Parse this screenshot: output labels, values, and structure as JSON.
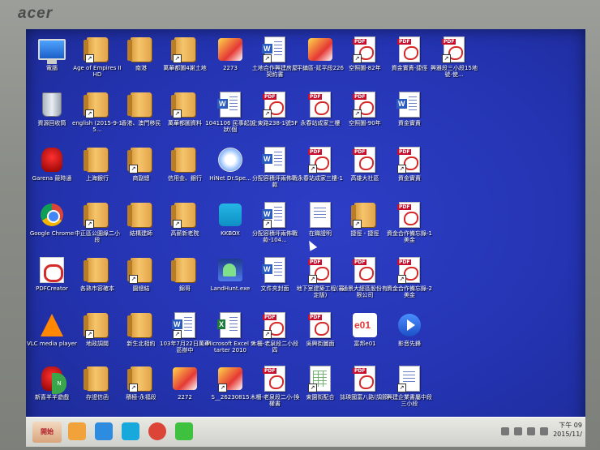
{
  "monitor": {
    "brand": "acer"
  },
  "desktop": {
    "icons": [
      {
        "name": "this-pc",
        "label": "電腦",
        "kind": "pc",
        "icon": "computer-icon"
      },
      {
        "name": "age-of-empires",
        "label": "Age of Empires II HD",
        "kind": "folder",
        "icon": "folder-icon"
      },
      {
        "name": "folder-nangang",
        "label": "南港",
        "kind": "folder",
        "icon": "folder-icon"
      },
      {
        "name": "folder-wanhua-map",
        "label": "萬華都圖4謝土地",
        "kind": "folder",
        "icon": "folder-icon"
      },
      {
        "name": "app-2273",
        "label": "2273",
        "kind": "wave",
        "icon": "image-icon"
      },
      {
        "name": "doc-land-cooperation",
        "label": "土地合作興建房屋契約書",
        "kind": "word",
        "icon": "word-doc-icon"
      },
      {
        "name": "doc-pingzhen",
        "label": "平鎮區-延平段226",
        "kind": "wave",
        "icon": "image-icon"
      },
      {
        "name": "pdf-aerial-82",
        "label": "空照圖-82年",
        "kind": "pdf",
        "icon": "pdf-icon"
      },
      {
        "name": "pdf-capital",
        "label": "資金實責-捷徑",
        "kind": "pdf",
        "icon": "pdf-icon"
      },
      {
        "name": "pdf-xingmei",
        "label": "興雅段三小段15地號-使...",
        "kind": "pdf",
        "icon": "pdf-icon"
      },
      {
        "name": "recycle-bin",
        "label": "資源回收筒",
        "kind": "bin",
        "icon": "recycle-bin-icon"
      },
      {
        "name": "folder-english",
        "label": "english (2015-9-15...",
        "kind": "folder",
        "icon": "folder-icon"
      },
      {
        "name": "folder-hk-macau",
        "label": "香港、澳門移民",
        "kind": "folder",
        "icon": "folder-icon"
      },
      {
        "name": "folder-wanhua-data",
        "label": "萬華都圖資料",
        "kind": "folder",
        "icon": "folder-icon"
      },
      {
        "name": "doc-1041106",
        "label": "1041106 民事起訴狀(個",
        "kind": "word",
        "icon": "word-doc-icon"
      },
      {
        "name": "pdf-shidong",
        "label": "士東路238-1號5F",
        "kind": "pdf",
        "icon": "pdf-icon"
      },
      {
        "name": "pdf-yongchun-1",
        "label": "永春站成家三樓",
        "kind": "pdf",
        "icon": "pdf-icon"
      },
      {
        "name": "pdf-aerial-90",
        "label": "空照圖-90年",
        "kind": "pdf",
        "icon": "pdf-icon"
      },
      {
        "name": "doc-capital",
        "label": "資金實責",
        "kind": "word",
        "icon": "word-doc-icon"
      },
      {
        "name": "garena",
        "label": "Garena 競時通",
        "kind": "garena",
        "icon": "garena-icon"
      },
      {
        "name": "folder-shanghai-bank",
        "label": "上海銀行",
        "kind": "folder",
        "icon": "folder-icon"
      },
      {
        "name": "folder-shangban",
        "label": "商副總",
        "kind": "folder",
        "icon": "folder-icon"
      },
      {
        "name": "folder-credit",
        "label": "信用金、銀行",
        "kind": "folder",
        "icon": "folder-icon"
      },
      {
        "name": "hinet",
        "label": "HiNet Dr.Spe...",
        "kind": "hinet",
        "icon": "hinet-icon"
      },
      {
        "name": "doc-allocation",
        "label": "分配容積坪兩佈戰款",
        "kind": "word",
        "icon": "word-doc-icon"
      },
      {
        "name": "pdf-yongchun-2",
        "label": "永春站成家三樓-1",
        "kind": "pdf",
        "icon": "pdf-icon"
      },
      {
        "name": "pdf-kaohsiung",
        "label": "高雄大社區",
        "kind": "pdf",
        "icon": "pdf-icon"
      },
      {
        "name": "pdf-capital-2",
        "label": "資金實責",
        "kind": "pdf",
        "icon": "pdf-icon"
      },
      {
        "name": "google-chrome",
        "label": "Google Chrome",
        "kind": "chrome",
        "icon": "chrome-icon"
      },
      {
        "name": "folder-zhongzheng",
        "label": "中正區公園綠二小段",
        "kind": "folder",
        "icon": "folder-icon"
      },
      {
        "name": "folder-construction",
        "label": "結構建師",
        "kind": "folder",
        "icon": "folder-icon"
      },
      {
        "name": "folder-gaoxin",
        "label": "高薪新老院",
        "kind": "folder",
        "icon": "folder-icon"
      },
      {
        "name": "kkbox",
        "label": "KKBOX",
        "kind": "kk",
        "icon": "kkbox-icon"
      },
      {
        "name": "doc-allocation-104",
        "label": "分配容積坪兩佈戰款-104...",
        "kind": "word",
        "icon": "word-doc-icon"
      },
      {
        "name": "doc-proof",
        "label": "在職證明",
        "kind": "doc",
        "icon": "document-icon"
      },
      {
        "name": "folder-shortcut",
        "label": "捷徑 - 捷徑",
        "kind": "folder",
        "icon": "folder-icon"
      },
      {
        "name": "pdf-coop-memo-1",
        "label": "資金合作備忘錄-1 美金",
        "kind": "pdf",
        "icon": "pdf-icon"
      },
      {
        "name": "pdfcreator",
        "label": "PDFCreator",
        "kind": "pdfc",
        "icon": "pdfcreator-icon"
      },
      {
        "name": "folder-customer",
        "label": "各熟市容確本",
        "kind": "folder",
        "icon": "folder-icon"
      },
      {
        "name": "folder-garden",
        "label": "園總結",
        "kind": "folder",
        "icon": "folder-icon"
      },
      {
        "name": "folder-jinge",
        "label": "錦哥",
        "kind": "folder",
        "icon": "folder-icon"
      },
      {
        "name": "landhunt",
        "label": "LandHunt.exe",
        "kind": "linehunt",
        "icon": "landhunt-icon"
      },
      {
        "name": "doc-envelope",
        "label": "文件夾封面",
        "kind": "word",
        "icon": "word-doc-icon"
      },
      {
        "name": "pdf-underground",
        "label": "地下室建築工程(審定版)",
        "kind": "pdf",
        "icon": "pdf-icon"
      },
      {
        "name": "pdf-tongyu",
        "label": "通景大經區股份有限公司",
        "kind": "pdf",
        "icon": "pdf-icon"
      },
      {
        "name": "pdf-coop-memo-2",
        "label": "資金合作備忘錄-2 美金",
        "kind": "pdf",
        "icon": "pdf-icon"
      },
      {
        "name": "vlc",
        "label": "VLC media player",
        "kind": "vlc",
        "icon": "vlc-icon"
      },
      {
        "name": "folder-earth",
        "label": "地政調閱",
        "kind": "folder",
        "icon": "folder-icon"
      },
      {
        "name": "folder-new-contract",
        "label": "新生北相約",
        "kind": "folder",
        "icon": "folder-icon"
      },
      {
        "name": "doc-103-7-22",
        "label": "103年7月22日萬華區辦中",
        "kind": "word",
        "icon": "word-doc-icon"
      },
      {
        "name": "excel-starter",
        "label": "Microsoft Excel Starter 2010",
        "kind": "excel",
        "icon": "excel-icon"
      },
      {
        "name": "pdf-muzha",
        "label": "木柵-老泉段二小段四",
        "kind": "pdf",
        "icon": "pdf-icon"
      },
      {
        "name": "pdf-wuxing",
        "label": "吳興街圖面",
        "kind": "pdf",
        "icon": "pdf-icon"
      },
      {
        "name": "e01",
        "label": "富邦e01",
        "kind": "e01",
        "icon": "e01-icon"
      },
      {
        "name": "video-master",
        "label": "影音先鋒",
        "kind": "play",
        "icon": "video-player-icon"
      },
      {
        "name": "pleasant-sheep",
        "label": "新喜羊羊遊戲",
        "kind": "garena",
        "icon": "game-icon"
      },
      {
        "name": "folder-storage",
        "label": "存證信函",
        "kind": "folder",
        "icon": "folder-icon"
      },
      {
        "name": "folder-jimei",
        "label": "積極-永福段",
        "kind": "folder",
        "icon": "folder-icon"
      },
      {
        "name": "img-2272",
        "label": "2272",
        "kind": "wave",
        "icon": "image-icon"
      },
      {
        "name": "img-s-26230815",
        "label": "S__26230815",
        "kind": "wave",
        "icon": "image-icon"
      },
      {
        "name": "pdf-muzha-2",
        "label": "木柵-老泉段二小-換權書",
        "kind": "pdf",
        "icon": "pdf-icon"
      },
      {
        "name": "sheet-dongyuan",
        "label": "東園街配合",
        "kind": "sheet",
        "icon": "spreadsheet-icon"
      },
      {
        "name": "pdf-street",
        "label": "誌瑛國富八路(調節)",
        "kind": "pdf",
        "icon": "pdf-icon"
      },
      {
        "name": "doc-guanwei",
        "label": "興建企業書屬中段三小段",
        "kind": "doc",
        "icon": "document-icon"
      }
    ]
  },
  "taskbar": {
    "start_label": "開始",
    "pinned": [
      {
        "name": "taskbar-apps",
        "icon": "app-grid-icon",
        "color": "#f2a23a"
      },
      {
        "name": "taskbar-ie",
        "icon": "internet-explorer-icon",
        "color": "#2d8be0"
      },
      {
        "name": "taskbar-kkbox",
        "icon": "kkbox-icon",
        "color": "#18a9dc"
      },
      {
        "name": "taskbar-chrome",
        "icon": "chrome-icon",
        "color": "#db4437"
      },
      {
        "name": "taskbar-line",
        "icon": "line-icon",
        "color": "#3ec13e"
      }
    ],
    "clock": {
      "time": "下午 09",
      "date": "2015/11/"
    }
  }
}
